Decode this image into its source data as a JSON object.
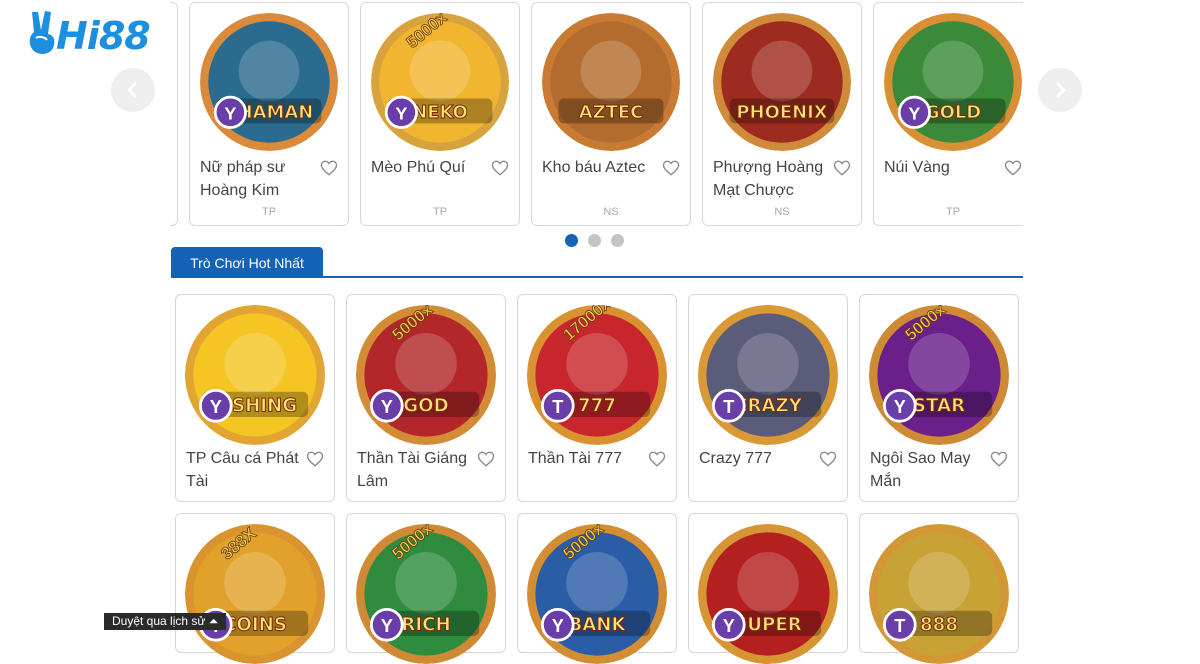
{
  "brand": {
    "logo_text": "Hi88",
    "icon": "victory-hand-icon",
    "color": "#1e8fe0",
    "accent": "#1463b8"
  },
  "carousel": {
    "prev_icon": "chevron-left-icon",
    "next_icon": "chevron-right-icon",
    "games": [
      {
        "art": "SHAMAN",
        "name": "Nữ pháp sư Hoàng Kim",
        "provider": "TP",
        "ring": "#d98a3a",
        "bg": "#2a6b8f",
        "badge": "Y"
      },
      {
        "art": "NEKO",
        "name": "Mèo Phú Quí",
        "provider": "TP",
        "ring": "#d8a33c",
        "bg": "#f2b530",
        "badge": "Y",
        "multiplier": "5000x"
      },
      {
        "art": "AZTEC",
        "name": "Kho báu Aztec",
        "provider": "NS",
        "ring": "#c97b34",
        "bg": "#b36c2e",
        "badge": ""
      },
      {
        "art": "PHOENIX",
        "name": "Phượng Hoàng Mạt Chược",
        "provider": "NS",
        "ring": "#cf8b39",
        "bg": "#9e2b1f",
        "badge": ""
      },
      {
        "art": "GOLD",
        "name": "Núi Vàng",
        "provider": "TP",
        "ring": "#d98f34",
        "bg": "#3a8a3a",
        "badge": "Y"
      }
    ],
    "page_dots": 3,
    "active_dot": 0
  },
  "hot_section": {
    "title": "Trò Chơi Hot Nhất"
  },
  "hot_games_row1": [
    {
      "art": "FISHING",
      "name": "TP Câu cá Phát Tài",
      "ring": "#e3a531",
      "bg": "#f5c524",
      "badge": "Y"
    },
    {
      "art": "GOD",
      "name": "Thần Tài Giáng Lâm",
      "ring": "#d48b36",
      "bg": "#b3262a",
      "badge": "Y",
      "multiplier": "5000x"
    },
    {
      "art": "777",
      "name": "Thần Tài 777",
      "ring": "#d9922f",
      "bg": "#c7262d",
      "badge": "T",
      "multiplier": "17000x"
    },
    {
      "art": "CRAZY",
      "name": "Crazy 777",
      "ring": "#d99a35",
      "bg": "#5b5b7a",
      "badge": "T"
    },
    {
      "art": "STAR",
      "name": "Ngôi Sao May Mắn",
      "ring": "#cf8a35",
      "bg": "#6a1f8a",
      "badge": "Y",
      "multiplier": "5000x"
    }
  ],
  "hot_games_row2": [
    {
      "art": "COINS",
      "ring": "#d9932f",
      "bg": "#e2a12a",
      "badge": "T",
      "multiplier": "388X"
    },
    {
      "art": "RICH",
      "ring": "#d08a36",
      "bg": "#2f8c3f",
      "badge": "Y",
      "multiplier": "5000x"
    },
    {
      "art": "BANK",
      "ring": "#d38d33",
      "bg": "#2b5ca6",
      "badge": "Y",
      "multiplier": "5000x"
    },
    {
      "art": "SUPER",
      "ring": "#d89534",
      "bg": "#b3201f",
      "badge": "Y"
    },
    {
      "art": "888",
      "ring": "#d49736",
      "bg": "#c9a235",
      "badge": "T"
    }
  ],
  "history_button": {
    "label": "Duyệt qua lịch sử ⏶"
  }
}
